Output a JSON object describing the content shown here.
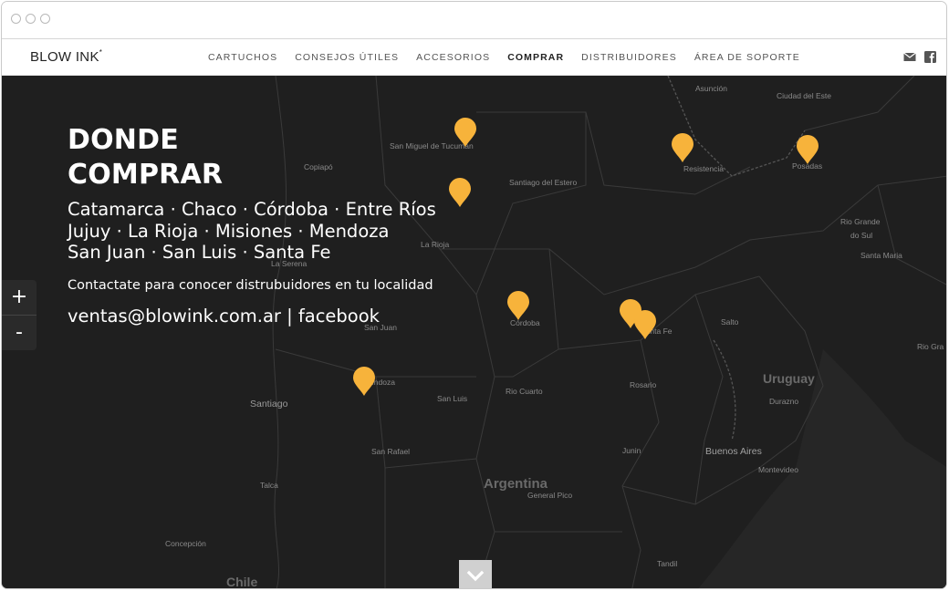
{
  "window": {
    "controls": [
      "close",
      "minimize",
      "maximize"
    ]
  },
  "brand": {
    "name": "BLOW INK",
    "mark": "*"
  },
  "nav": {
    "items": [
      {
        "label": "CARTUCHOS",
        "active": false
      },
      {
        "label": "CONSEJOS ÚTILES",
        "active": false
      },
      {
        "label": "ACCESORIOS",
        "active": false
      },
      {
        "label": "COMPRAR",
        "active": true
      },
      {
        "label": "DISTRIBUIDORES",
        "active": false
      },
      {
        "label": "ÁREA DE SOPORTE",
        "active": false
      }
    ],
    "icons": [
      "mail-icon",
      "facebook-icon"
    ]
  },
  "hero": {
    "title_line1": "DONDE",
    "title_line2": "COMPRAR",
    "regions_line1": "Catamarca · Chaco · Córdoba · Entre Ríos",
    "regions_line2": "Jujuy · La Rioja · Misiones · Mendoza",
    "regions_line3": "San Juan · San Luis · Santa Fe",
    "contact_text": "Contactate para conocer distrubuidores en tu localidad",
    "email": "ventas@blowink.com.ar",
    "separator": "|",
    "facebook": "facebook"
  },
  "map": {
    "zoom_in": "+",
    "zoom_out": "-",
    "countries": [
      "Argentina",
      "Uruguay",
      "Chile"
    ],
    "cities": {
      "asuncion": "Asunción",
      "ciudad_del_este": "Ciudad del Este",
      "san_miguel": "San Miguel de Tucumán",
      "copiapo": "Copiapó",
      "santiago_del_estero": "Santiago del Estero",
      "resistencia": "Resistencia",
      "posadas": "Posadas",
      "rio_grande_1": "Rio Grande",
      "rio_grande_2": "do Sul",
      "santa_maria": "Santa Maria",
      "la_rioja": "La Rioja",
      "la_serena": "La Serena",
      "san_juan": "San Juan",
      "cordoba": "Córdoba",
      "santa_fe": "Santa Fe",
      "salto": "Salto",
      "mendoza": "Mendoza",
      "rosario": "Rosario",
      "rio_cuarto": "Rio Cuarto",
      "san_luis": "San Luis",
      "santiago": "Santiago",
      "durazno": "Durazno",
      "junin": "Junin",
      "buenos_aires": "Buenos Aires",
      "san_rafael": "San Rafael",
      "montevideo": "Montevideo",
      "talca": "Talca",
      "general_pico": "General Pico",
      "concepcion": "Concepción",
      "tandil": "Tandil",
      "rio_gra": "Rio Gra"
    },
    "pin_color": "#f7b33b",
    "background": "#1f1f1f"
  },
  "scroll_icon": "chevron-down-icon"
}
